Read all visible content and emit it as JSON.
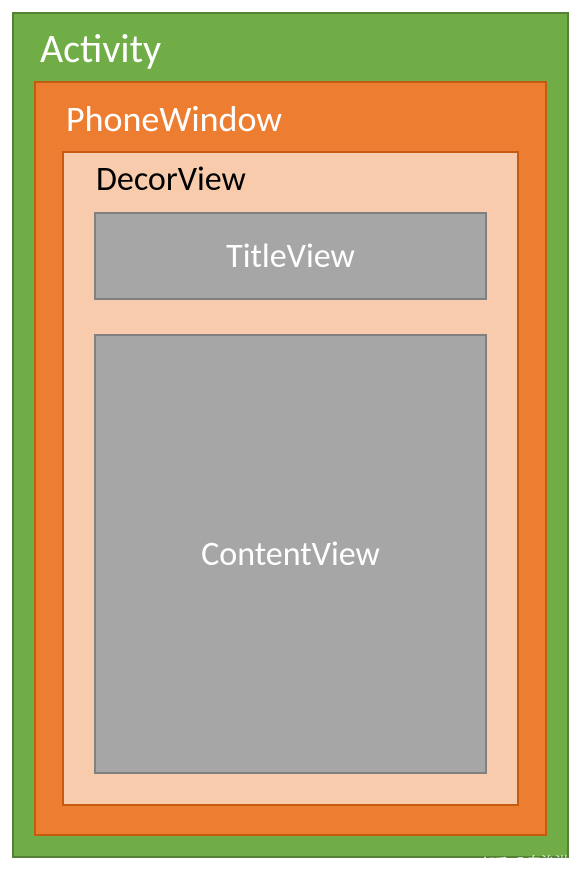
{
  "diagram": {
    "activity": {
      "label": "Activity",
      "color": "#70AD47"
    },
    "phoneWindow": {
      "label": "PhoneWindow",
      "color": "#ED7D31"
    },
    "decorView": {
      "label": "DecorView",
      "color": "#F8CBAD"
    },
    "titleView": {
      "label": "TitleView",
      "color": "#A6A6A6"
    },
    "contentView": {
      "label": "ContentView",
      "color": "#A6A6A6"
    }
  },
  "watermark": {
    "site": "知乎",
    "author": "@向治洪"
  }
}
